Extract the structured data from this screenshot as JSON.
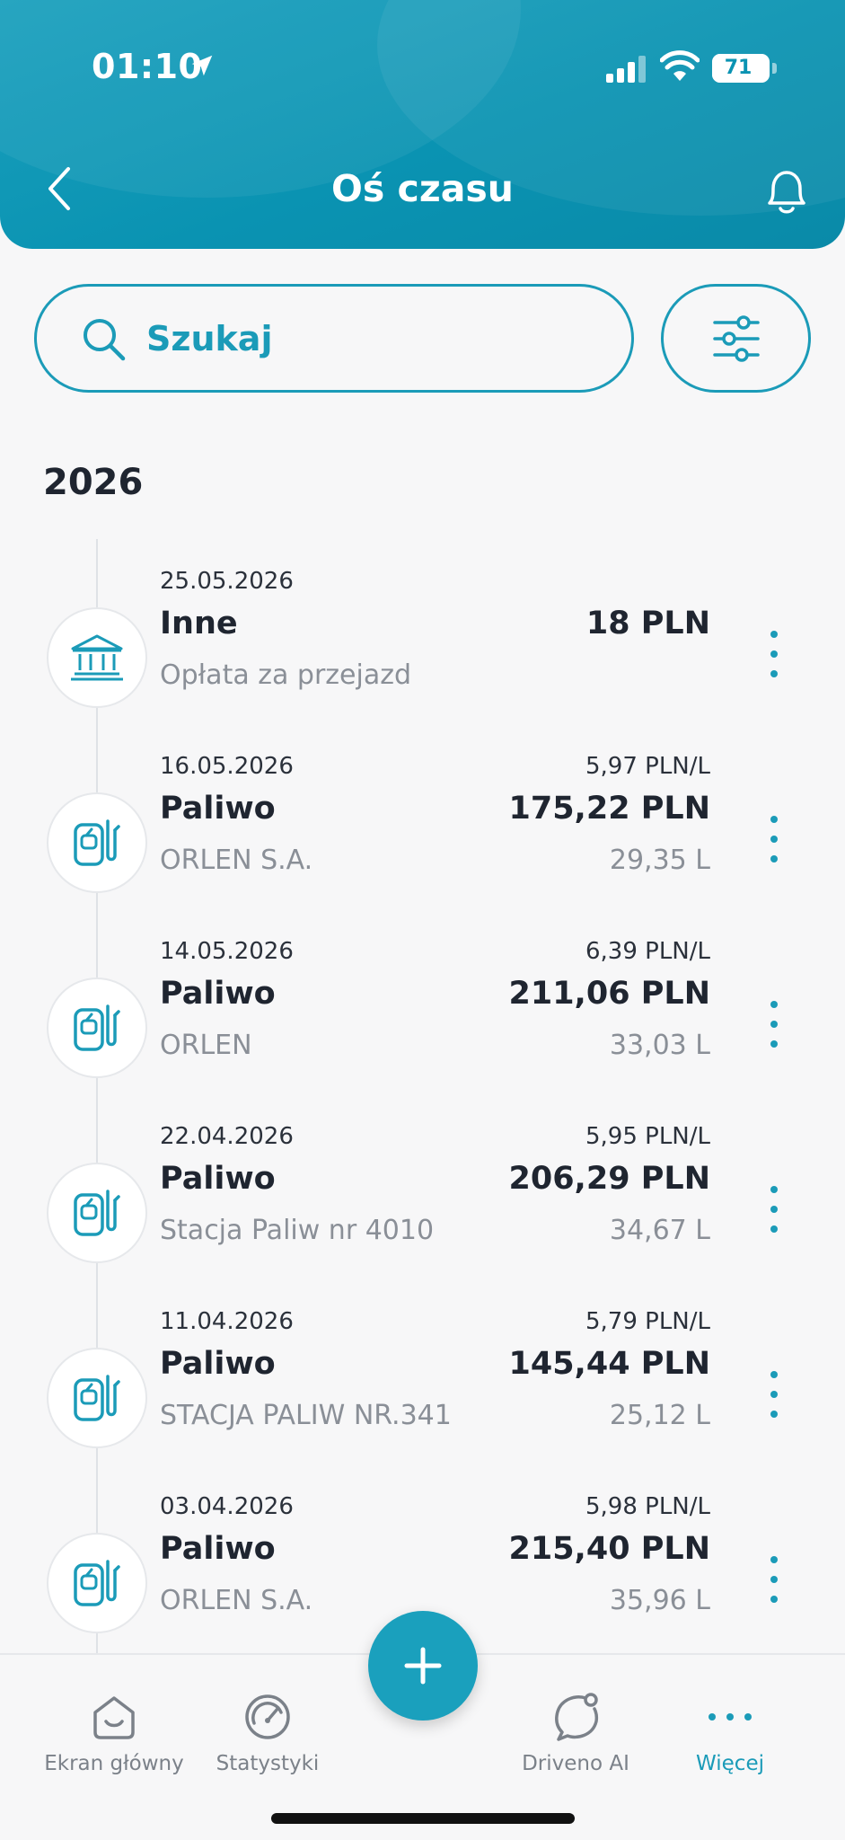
{
  "status_bar": {
    "time": "01:10",
    "battery": "71"
  },
  "header": {
    "title": "Oś czasu"
  },
  "search": {
    "placeholder": "Szukaj"
  },
  "year": "2026",
  "entries": [
    {
      "date": "25.05.2026",
      "category": "Inne",
      "place": "Opłata za przejazd",
      "amount": "18 PLN",
      "rate": "",
      "volume": "",
      "icon": "bank-icon"
    },
    {
      "date": "16.05.2026",
      "category": "Paliwo",
      "place": "ORLEN S.A.",
      "amount": "175,22 PLN",
      "rate": "5,97 PLN/L",
      "volume": "29,35 L",
      "icon": "fuel-pump-icon"
    },
    {
      "date": "14.05.2026",
      "category": "Paliwo",
      "place": "ORLEN",
      "amount": "211,06 PLN",
      "rate": "6,39 PLN/L",
      "volume": "33,03 L",
      "icon": "fuel-pump-icon"
    },
    {
      "date": "22.04.2026",
      "category": "Paliwo",
      "place": "Stacja Paliw nr 4010",
      "amount": "206,29 PLN",
      "rate": "5,95 PLN/L",
      "volume": "34,67 L",
      "icon": "fuel-pump-icon"
    },
    {
      "date": "11.04.2026",
      "category": "Paliwo",
      "place": "STACJA PALIW NR.341",
      "amount": "145,44 PLN",
      "rate": "5,79 PLN/L",
      "volume": "25,12 L",
      "icon": "fuel-pump-icon"
    },
    {
      "date": "03.04.2026",
      "category": "Paliwo",
      "place": "ORLEN S.A.",
      "amount": "215,40 PLN",
      "rate": "5,98 PLN/L",
      "volume": "35,96 L",
      "icon": "fuel-pump-icon"
    }
  ],
  "nav": {
    "home": "Ekran główny",
    "stats": "Statystyki",
    "ai": "Driveno AI",
    "more": "Więcej"
  },
  "colors": {
    "accent": "#1b9bb8",
    "header": "#0a93b2"
  }
}
